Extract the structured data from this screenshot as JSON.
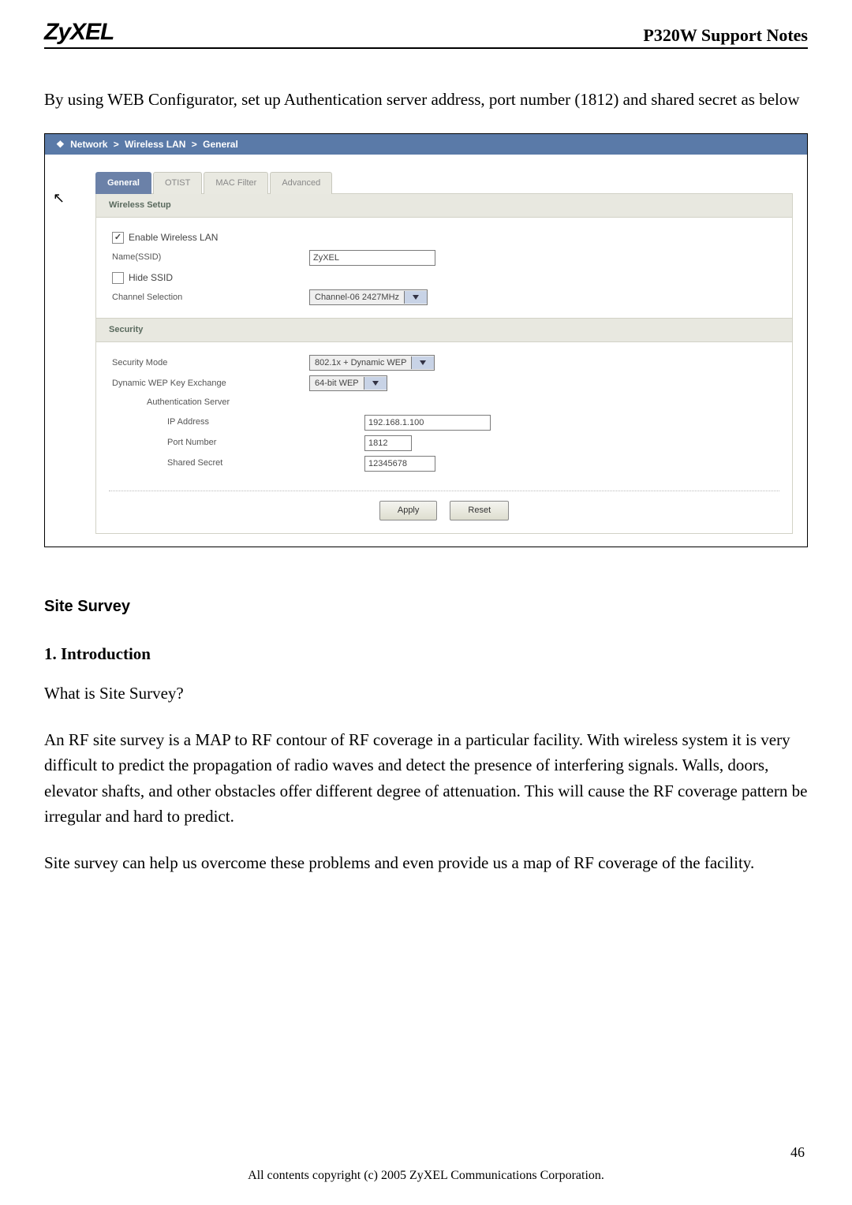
{
  "header": {
    "logo": "ZyXEL",
    "doc_title": "P320W Support Notes"
  },
  "intro_para": "By using WEB Configurator, set up Authentication server address, port number (1812) and shared secret as below",
  "shot": {
    "breadcrumb": [
      "Network",
      "Wireless LAN",
      "General"
    ],
    "tabs": [
      {
        "label": "General",
        "active": true
      },
      {
        "label": "OTIST",
        "active": false
      },
      {
        "label": "MAC Filter",
        "active": false
      },
      {
        "label": "Advanced",
        "active": false
      }
    ],
    "wireless": {
      "section": "Wireless Setup",
      "enable": {
        "label": "Enable Wireless LAN",
        "checked": true
      },
      "ssid": {
        "label": "Name(SSID)",
        "value": "ZyXEL"
      },
      "hide": {
        "label": "Hide SSID",
        "checked": false
      },
      "channel": {
        "label": "Channel Selection",
        "value": "Channel-06 2427MHz"
      }
    },
    "security": {
      "section": "Security",
      "mode": {
        "label": "Security Mode",
        "value": "802.1x + Dynamic WEP"
      },
      "dwep": {
        "label": "Dynamic WEP Key Exchange",
        "value": "64-bit WEP"
      },
      "auth_hdr": "Authentication Server",
      "ip": {
        "label": "IP Address",
        "value": "192.168.1.100"
      },
      "port": {
        "label": "Port Number",
        "value": "1812"
      },
      "secret": {
        "label": "Shared Secret",
        "value": "12345678"
      }
    },
    "buttons": {
      "apply": "Apply",
      "reset": "Reset"
    }
  },
  "site_survey": {
    "title": "Site Survey",
    "sec1_title": "1. Introduction",
    "q": "What is Site Survey?",
    "p1": "An RF site survey is a MAP to RF contour of RF coverage in a particular facility.   With wireless system it is very difficult to predict the propagation of radio waves and detect the presence of interfering signals. Walls, doors, elevator shafts, and other obstacles offer different degree of attenuation. This will cause the RF coverage pattern be irregular and hard to predict.",
    "p2": "Site survey can help us overcome these problems and even provide us a map of RF coverage of the facility."
  },
  "footer": {
    "copyright": "All contents copyright (c) 2005 ZyXEL Communications Corporation.",
    "page": "46"
  }
}
